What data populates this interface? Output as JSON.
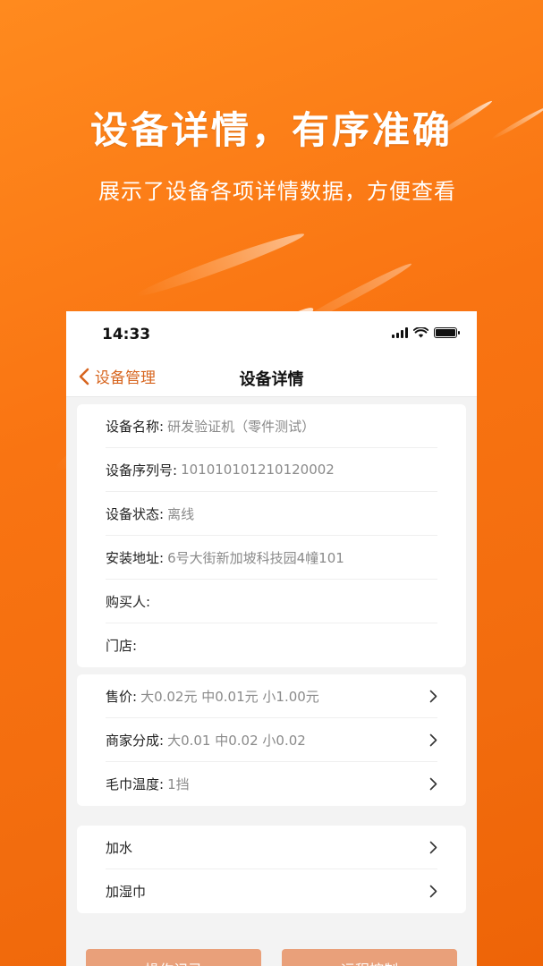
{
  "promo": {
    "headline": "设备详情，有序准确",
    "subline": "展示了设备各项详情数据，方便查看"
  },
  "phone": {
    "status": {
      "time": "14:33"
    },
    "nav": {
      "back_label": "设备管理",
      "title": "设备详情"
    },
    "info": [
      {
        "label": "设备名称:",
        "value": "研发验证机（零件测试）"
      },
      {
        "label": "设备序列号:",
        "value": "101010101210120002"
      },
      {
        "label": "设备状态:",
        "value": "离线"
      },
      {
        "label": "安装地址:",
        "value": "6号大街新加坡科技园4幢101"
      },
      {
        "label": "购买人:",
        "value": ""
      },
      {
        "label": "门店:",
        "value": ""
      }
    ],
    "settings": [
      {
        "label": "售价:",
        "value": "大0.02元  中0.01元  小1.00元"
      },
      {
        "label": "商家分成:",
        "value": "大0.01  中0.02  小0.02"
      },
      {
        "label": "毛巾温度:",
        "value": "1挡"
      }
    ],
    "actions": [
      {
        "label": "加水"
      },
      {
        "label": "加湿巾"
      }
    ],
    "buttons": [
      {
        "label": "操作记录"
      },
      {
        "label": "远程控制"
      }
    ]
  },
  "colors": {
    "accent": "#d7651f",
    "background": "#f97412",
    "button": "#e9a07a"
  }
}
